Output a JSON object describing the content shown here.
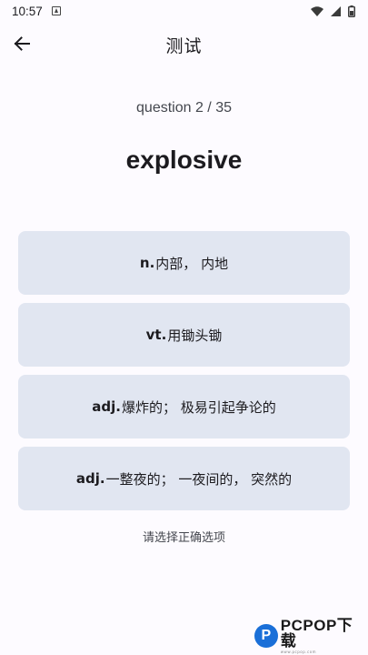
{
  "status_bar": {
    "time": "10:57",
    "icons": [
      "notification-a-icon",
      "wifi-icon",
      "cell-signal-icon",
      "battery-icon"
    ]
  },
  "app_bar": {
    "title": "测试",
    "back_icon": "arrow-left-icon"
  },
  "quiz": {
    "counter": "question 2 / 35",
    "word": "explosive",
    "options": [
      {
        "pos": "n.",
        "meaning": "内部， 内地"
      },
      {
        "pos": "vt.",
        "meaning": "用锄头锄"
      },
      {
        "pos": "adj.",
        "meaning": " 爆炸的； 极易引起争论的"
      },
      {
        "pos": "adj.",
        "meaning": " 一整夜的； 一夜间的， 突然的"
      }
    ],
    "hint": "请选择正确选项"
  },
  "watermark": {
    "logo_letter": "P",
    "text": "PCPOP下载",
    "subtext": "www.pcpop.com"
  },
  "colors": {
    "background": "#fdfbff",
    "option_background": "#e1e6f1",
    "text": "#1c1b1f",
    "brand_blue": "#1a6fd8"
  }
}
